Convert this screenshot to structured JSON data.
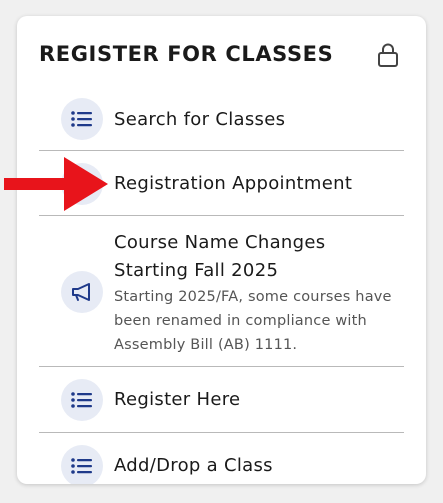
{
  "section": {
    "title": "REGISTER FOR CLASSES",
    "lock_icon": "lock-icon"
  },
  "menu": {
    "items": [
      {
        "label": "Search for Classes",
        "icon": "list-icon"
      },
      {
        "label": "Registration Appointment",
        "icon": "list-icon"
      },
      {
        "label_line1": "Course Name Changes",
        "label_line2": "Starting Fall 2025",
        "description": "Starting 2025/FA, some courses have been renamed in compliance with Assembly Bill (AB) 1111.",
        "icon": "megaphone-icon"
      },
      {
        "label": "Register Here",
        "icon": "list-icon"
      },
      {
        "label": "Add/Drop a Class",
        "icon": "list-icon"
      }
    ]
  },
  "annotation": {
    "type": "red-arrow-pointer",
    "color": "#e8141b",
    "points_to": "Registration Appointment"
  },
  "colors": {
    "icon_blue": "#1f3a8a",
    "icon_bg": "#e7ebf5",
    "divider": "#b9b9b9"
  }
}
